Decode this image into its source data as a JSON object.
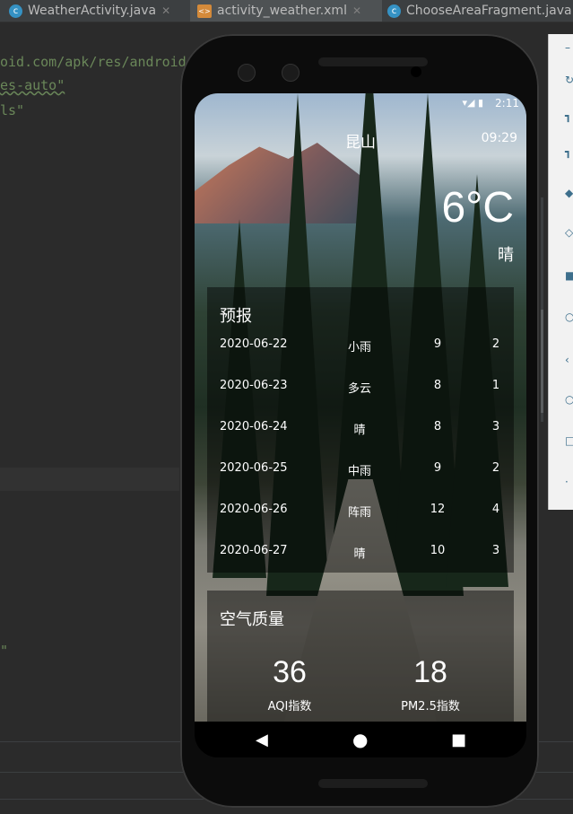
{
  "ide": {
    "tabs": [
      {
        "label": "WeatherActivity.java",
        "icon": "class-c-icon"
      },
      {
        "label": "activity_weather.xml",
        "icon": "xml-layout-icon"
      },
      {
        "label": "ChooseAreaFragment.java",
        "icon": "class-c-icon"
      }
    ],
    "code_lines": [
      "oid.com/apk/res/android",
      "es-auto\"",
      "ls\"",
      "\""
    ]
  },
  "phone": {
    "status_time": "2:11",
    "city": "昆山",
    "update_time": "09:29",
    "degree": "6°C",
    "weather_info": "晴",
    "forecast_title": "预报",
    "forecast": [
      {
        "date": "2020-06-22",
        "info": "小雨",
        "max": "9",
        "min": "2"
      },
      {
        "date": "2020-06-23",
        "info": "多云",
        "max": "8",
        "min": "1"
      },
      {
        "date": "2020-06-24",
        "info": "晴",
        "max": "8",
        "min": "3"
      },
      {
        "date": "2020-06-25",
        "info": "中雨",
        "max": "9",
        "min": "2"
      },
      {
        "date": "2020-06-26",
        "info": "阵雨",
        "max": "12",
        "min": "4"
      },
      {
        "date": "2020-06-27",
        "info": "晴",
        "max": "10",
        "min": "3"
      }
    ],
    "aqi_title": "空气质量",
    "aqi_value": "36",
    "aqi_label": "AQI指数",
    "pm25_value": "18",
    "pm25_label": "PM2.5指数"
  }
}
